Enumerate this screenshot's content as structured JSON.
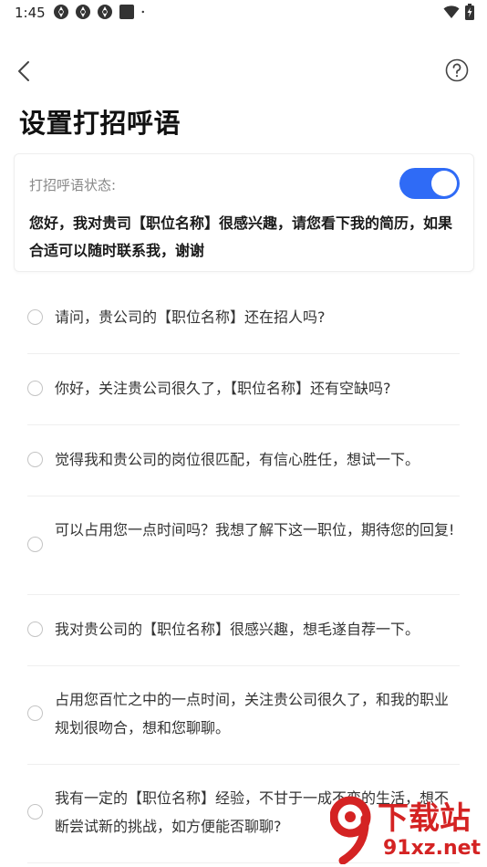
{
  "status_bar": {
    "time": "1:45",
    "icons": [
      "app-notification-icon",
      "app-notification-icon",
      "app-notification-icon",
      "square-notification-icon",
      "dot-icon"
    ],
    "right_icons": [
      "wifi-icon",
      "battery-charging-icon"
    ]
  },
  "navbar": {
    "back_icon": "chevron-left-icon",
    "help_icon": "question-circle-icon"
  },
  "page": {
    "title": "设置打招呼语"
  },
  "card": {
    "status_label": "打招呼语状态:",
    "toggle_on": true,
    "current_greeting": "您好，我对贵司【职位名称】很感兴趣，请您看下我的简历，如果合适可以随时联系我，谢谢"
  },
  "options": [
    {
      "text": "请问，贵公司的【职位名称】还在招人吗?"
    },
    {
      "text": "你好，关注贵公司很久了，【职位名称】还有空缺吗?"
    },
    {
      "text": "觉得我和贵公司的岗位很匹配，有信心胜任，想试一下。"
    },
    {
      "text": "可以占用您一点时间吗？我想了解下这一职位，期待您的回复!"
    },
    {
      "text": "我对贵公司的【职位名称】很感兴趣，想毛遂自荐一下。"
    },
    {
      "text": "占用您百忙之中的一点时间，关注贵公司很久了，和我的职业规划很吻合，想和您聊聊。"
    },
    {
      "text": "我有一定的【职位名称】经验，不甘于一成不变的生活，想不断尝试新的挑战，如方便能否聊聊?"
    }
  ],
  "watermark": {
    "line1": "下载站",
    "line2": "91xz.net"
  },
  "colors": {
    "accent": "#2f6bf6",
    "watermark": "#d42323"
  }
}
